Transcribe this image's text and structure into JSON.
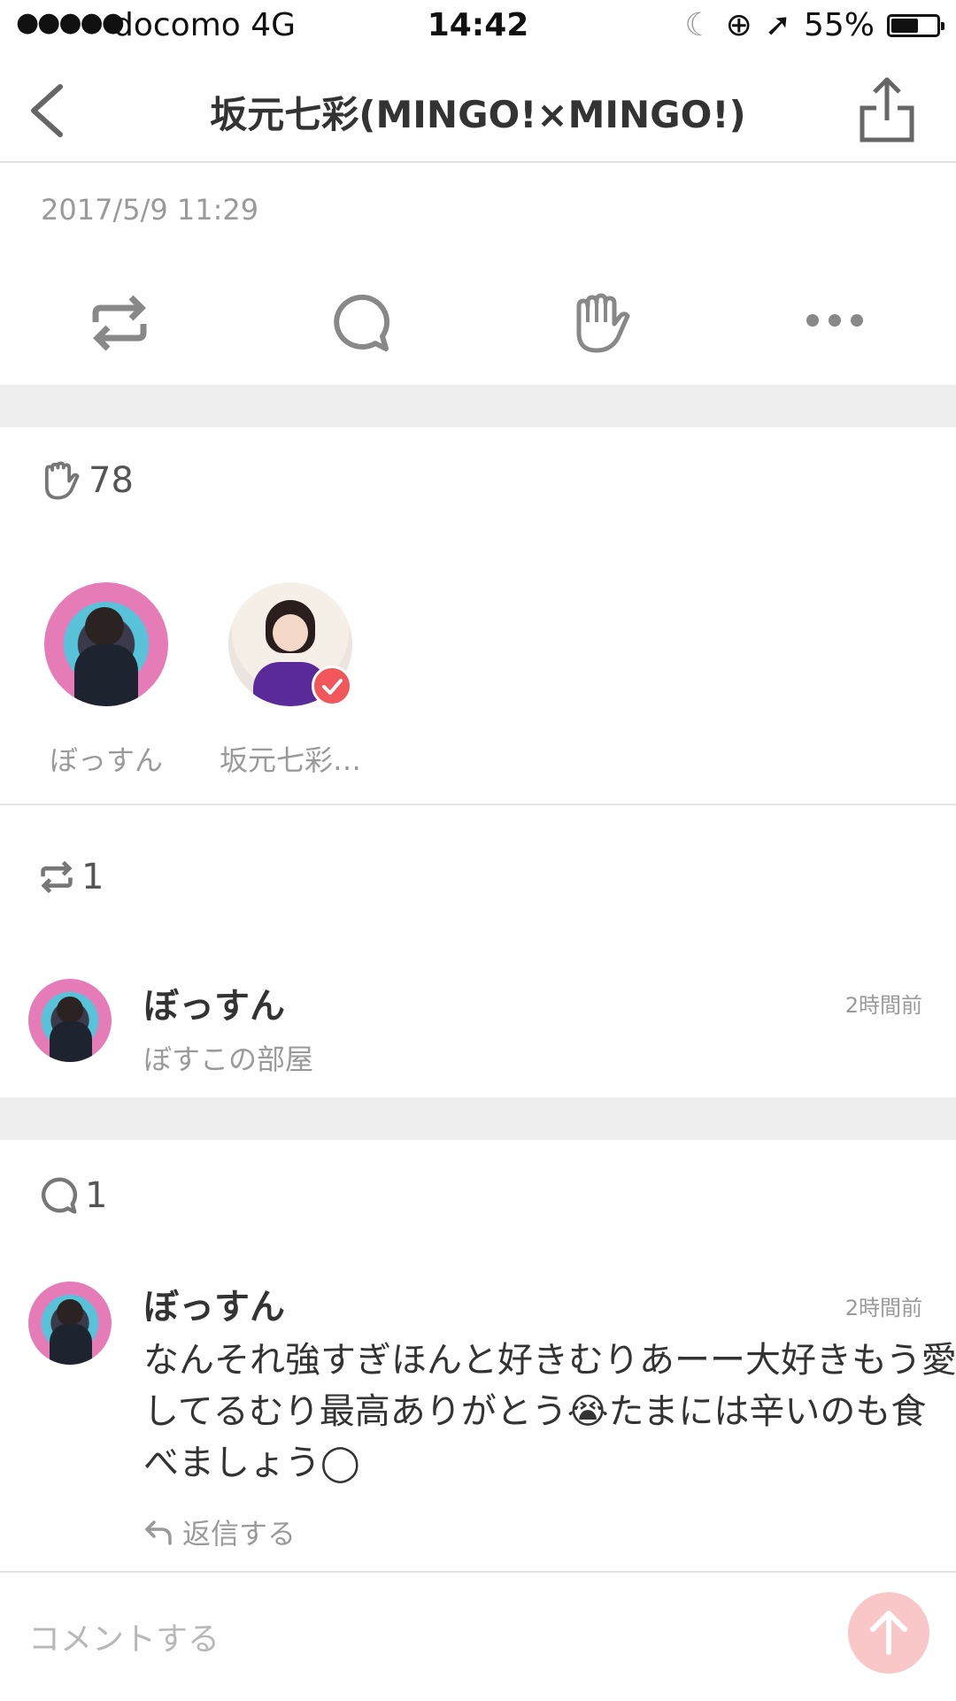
{
  "status_bar": {
    "signal": "●●●●●",
    "carrier": "docomo  4G",
    "time": "14:42",
    "battery": "55%",
    "battery_level": 0.55
  },
  "nav": {
    "title": "坂元七彩(MINGO!×MINGO!)"
  },
  "post": {
    "date": "2017/5/9 11:29"
  },
  "icons": [
    "chevron-left-icon",
    "share-icon",
    "repost-icon",
    "comment-icon",
    "clap-icon",
    "more-icon",
    "send-arrow-icon",
    "reply-arrow-icon"
  ],
  "likes": {
    "count": "78",
    "users": [
      {
        "name": "ぼっすん"
      },
      {
        "name": "坂元七彩…"
      }
    ]
  },
  "reposts": {
    "count": "1",
    "items": [
      {
        "name": "ぼっすん",
        "subtitle": "ぼすこの部屋",
        "time": "2時間前"
      }
    ]
  },
  "comments": {
    "count": "1",
    "items": [
      {
        "name": "ぼっすん",
        "time": "2時間前",
        "text": "なんそれ強すぎほんと好きむりあーー大好きもう愛してるむり最高ありがとう😭たまには辛いのも食べましょう◯",
        "reply_label": "返信する"
      }
    ]
  },
  "input": {
    "placeholder": "コメントする"
  },
  "colors": {
    "accent": "#f0565a",
    "send_button": "#f9c7c7",
    "band": "#eeeeee"
  }
}
